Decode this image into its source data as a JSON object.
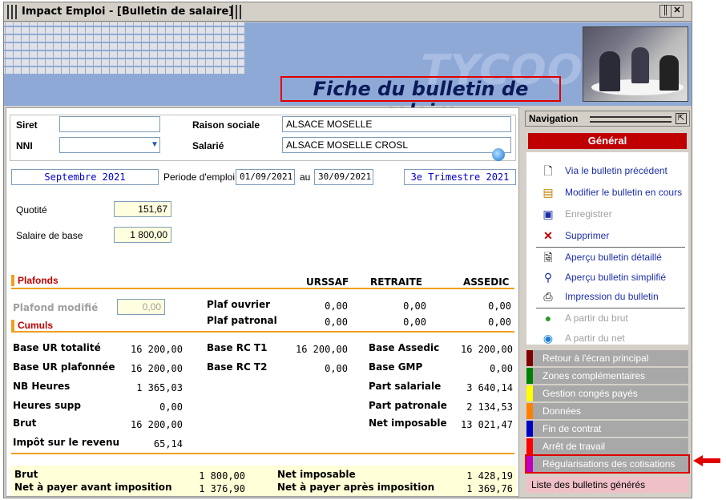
{
  "window": {
    "title": "Impact Emploi - [Bulletin de salaire]"
  },
  "banner": {
    "brand": "TYCOON",
    "heading": "Fiche du bulletin de salaire"
  },
  "identity": {
    "siret_label": "Siret",
    "siret_value": "",
    "nni_label": "NNI",
    "nni_value": "",
    "raison_label": "Raison sociale",
    "raison_value": "ALSACE MOSELLE",
    "salarie_label": "Salarié",
    "salarie_value": "ALSACE MOSELLE CROSL"
  },
  "period": {
    "month": "Septembre 2021",
    "periode_label": "Periode d'emploi",
    "from": "01/09/2021",
    "au_label": "au",
    "to": "30/09/2021",
    "quarter": "3e Trimestre  2021"
  },
  "base": {
    "quotite_label": "Quotité",
    "quotite_value": "151,67",
    "salaire_label": "Salaire de base",
    "salaire_value": "1 800,00"
  },
  "plafonds": {
    "section_label": "Plafonds",
    "col_urssaf": "URSSAF",
    "col_retraite": "RETRAITE",
    "col_assedic": "ASSEDIC",
    "plafond_modifie_label": "Plafond modifié",
    "plafond_modifie_value": "0,00",
    "plaf_ouvrier_label": "Plaf ouvrier",
    "plaf_ouvrier_urssaf": "0,00",
    "plaf_ouvrier_retraite": "0,00",
    "plaf_ouvrier_assedic": "0,00",
    "plaf_patronal_label": "Plaf patronal",
    "plaf_patronal_urssaf": "0,00",
    "plaf_patronal_retraite": "0,00",
    "plaf_patronal_assedic": "0,00"
  },
  "cumuls": {
    "section_label": "Cumuls",
    "left": [
      {
        "label": "Base UR totalité",
        "value": "16 200,00"
      },
      {
        "label": "Base UR plafonnée",
        "value": "16 200,00"
      },
      {
        "label": "NB Heures",
        "value": "1 365,03"
      },
      {
        "label": "Heures supp",
        "value": "0,00"
      },
      {
        "label": "Brut",
        "value": "16 200,00"
      },
      {
        "label": "Impôt sur le revenu",
        "value": "65,14"
      }
    ],
    "middle": [
      {
        "label": "Base RC T1",
        "value": "16 200,00"
      },
      {
        "label": "Base RC T2",
        "value": "0,00"
      }
    ],
    "right": [
      {
        "label": "Base Assedic",
        "value": "16 200,00"
      },
      {
        "label": "Base GMP",
        "value": "0,00"
      },
      {
        "label": "Part salariale",
        "value": "3 640,14"
      },
      {
        "label": "Part patronale",
        "value": "2 134,53"
      },
      {
        "label": "Net imposable",
        "value": "13 021,47"
      }
    ]
  },
  "totals": {
    "brut_label": "Brut",
    "brut_value": "1 800,00",
    "net_avant_label": "Net à payer avant imposition",
    "net_avant_value": "1 376,90",
    "net_imposable_label": "Net imposable",
    "net_imposable_value": "1 428,19",
    "net_apres_label": "Net à payer après imposition",
    "net_apres_value": "1 369,76"
  },
  "navigation": {
    "title": "Navigation",
    "general": "Général",
    "actions": [
      {
        "label": "Via le bulletin précédent",
        "enabled": true
      },
      {
        "label": "Modifier le bulletin en cours",
        "enabled": true
      },
      {
        "label": "Enregistrer",
        "enabled": false
      },
      {
        "label": "Supprimer",
        "enabled": true
      },
      {
        "label": "Aperçu bulletin détaillé",
        "enabled": true
      },
      {
        "label": "Aperçu bulletin simplifié",
        "enabled": true
      },
      {
        "label": "Impression du bulletin",
        "enabled": true
      },
      {
        "label": "A partir du brut",
        "enabled": false
      },
      {
        "label": "A partir du net",
        "enabled": false
      }
    ],
    "categories": [
      {
        "label": "Retour à l'écran principal",
        "color": "#800000"
      },
      {
        "label": "Zones complémentaires",
        "color": "#008000"
      },
      {
        "label": "Gestion congés payés",
        "color": "#ffff00"
      },
      {
        "label": "Données conventionnelles,Pénibilité",
        "color": "#ff8000"
      },
      {
        "label": "Fin de contrat",
        "color": "#0000c0"
      },
      {
        "label": "Arrêt de travail",
        "color": "#ff0000"
      },
      {
        "label": "Régularisations des cotisations",
        "color": "#c000c0"
      }
    ],
    "list_label": "Liste des bulletins générés"
  }
}
